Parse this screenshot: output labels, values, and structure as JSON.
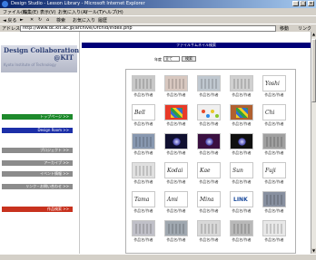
{
  "window": {
    "title": "Design Studio - Lesson Library - Microsoft Internet Explorer",
    "minimize": "_",
    "maximize": "□",
    "close": "×"
  },
  "menu": [
    "ファイル(F)",
    "編集(E)",
    "表示(V)",
    "お気に入り(A)",
    "ツール(T)",
    "ヘルプ(H)"
  ],
  "toolbar": {
    "back": "◄ 戻る",
    "forward": "►",
    "stop": "✕",
    "refresh": "↻",
    "home": "⌂",
    "search": "検索",
    "favorites": "お気に入り",
    "history": "履歴"
  },
  "address": {
    "label": "アドレス",
    "url": "http://www.dc.kit.ac.jp/archive/Orchid/index.php",
    "go": "移動",
    "links": "リンク"
  },
  "logo": {
    "line1": "Design Collaboration",
    "line2": "@KIT",
    "sub": "Kyoto Institute of Technology"
  },
  "nav": [
    {
      "label": "トップページ  >>",
      "color": "#1e8a2c"
    },
    {
      "label": "Design Room  >>",
      "color": "#1c2fa8"
    },
    {
      "label": "プロジェクト  >>",
      "color": "#8c8c8c"
    },
    {
      "label": "アーカイブ  >>",
      "color": "#8c8c8c"
    },
    {
      "label": "イベント情報  >>",
      "color": "#8c8c8c"
    },
    {
      "label": "リンク・お問い合わせ  >>",
      "color": "#8c8c8c"
    },
    {
      "label": "作品検索  >>",
      "color": "#c8321e"
    }
  ],
  "main": {
    "banner": "ファイルサムネイル検索",
    "search_label": "年度",
    "search_value": "全て",
    "search_button": "検索"
  },
  "grid": [
    {
      "caption": "作品名/作者",
      "kind": "pattern",
      "color": "#c8c8c8"
    },
    {
      "caption": "作品名/作者",
      "kind": "pattern",
      "color": "#d8c8c0"
    },
    {
      "caption": "作品名/作者",
      "kind": "pattern",
      "color": "#c0c8d0"
    },
    {
      "caption": "作品名/作者",
      "kind": "pattern",
      "color": "#d0d0d0"
    },
    {
      "caption": "作品名/作者",
      "kind": "logo",
      "text": "Yoshi",
      "color": "#ffffff"
    },
    {
      "caption": "作品名/作者",
      "kind": "logo",
      "text": "Bell",
      "color": "#ffffff"
    },
    {
      "caption": "作品名/作者",
      "kind": "color",
      "color": "#e83a28"
    },
    {
      "caption": "作品名/作者",
      "kind": "dots",
      "color": "#f0f0f0"
    },
    {
      "caption": "作品名/作者",
      "kind": "color",
      "color": "#b06030"
    },
    {
      "caption": "作品名/作者",
      "kind": "logo",
      "text": "Chi",
      "color": "#ffffff"
    },
    {
      "caption": "作品名/作者",
      "kind": "photo",
      "color": "#8898b0"
    },
    {
      "caption": "作品名/作者",
      "kind": "dark",
      "color": "#101030"
    },
    {
      "caption": "作品名/作者",
      "kind": "dark",
      "color": "#3a1040"
    },
    {
      "caption": "作品名/作者",
      "kind": "dark",
      "color": "#101010"
    },
    {
      "caption": "作品名/作者",
      "kind": "photo",
      "color": "#a0a0a0"
    },
    {
      "caption": "作品名/作者",
      "kind": "pattern",
      "color": "#e0e0e0"
    },
    {
      "caption": "作品名/作者",
      "kind": "logo",
      "text": "Kodai",
      "color": "#ffffff"
    },
    {
      "caption": "作品名/作者",
      "kind": "logo",
      "text": "Kae",
      "color": "#ffffff"
    },
    {
      "caption": "作品名/作者",
      "kind": "logo",
      "text": "Sun",
      "color": "#ffffff"
    },
    {
      "caption": "作品名/作者",
      "kind": "logo",
      "text": "Fuji",
      "color": "#ffffff"
    },
    {
      "caption": "作品名/作者",
      "kind": "logo",
      "text": "Tama",
      "color": "#ffffff"
    },
    {
      "caption": "作品名/作者",
      "kind": "logo",
      "text": "Ami",
      "color": "#ffffff"
    },
    {
      "caption": "作品名/作者",
      "kind": "logo",
      "text": "Mina",
      "color": "#ffffff"
    },
    {
      "caption": "作品名/作者",
      "kind": "brand",
      "text": "LINK",
      "color": "#ffffff"
    },
    {
      "caption": "作品名/作者",
      "kind": "photo",
      "color": "#8890a0"
    },
    {
      "caption": "作品名/作者",
      "kind": "photo",
      "color": "#c0c0c8"
    },
    {
      "caption": "作品名/作者",
      "kind": "photo",
      "color": "#a0a8b0"
    },
    {
      "caption": "作品名/作者",
      "kind": "pattern",
      "color": "#d8d8d8"
    },
    {
      "caption": "作品名/作者",
      "kind": "photo",
      "color": "#b8b8b8"
    },
    {
      "caption": "作品名/作者",
      "kind": "pattern",
      "color": "#e8e8e8"
    }
  ]
}
